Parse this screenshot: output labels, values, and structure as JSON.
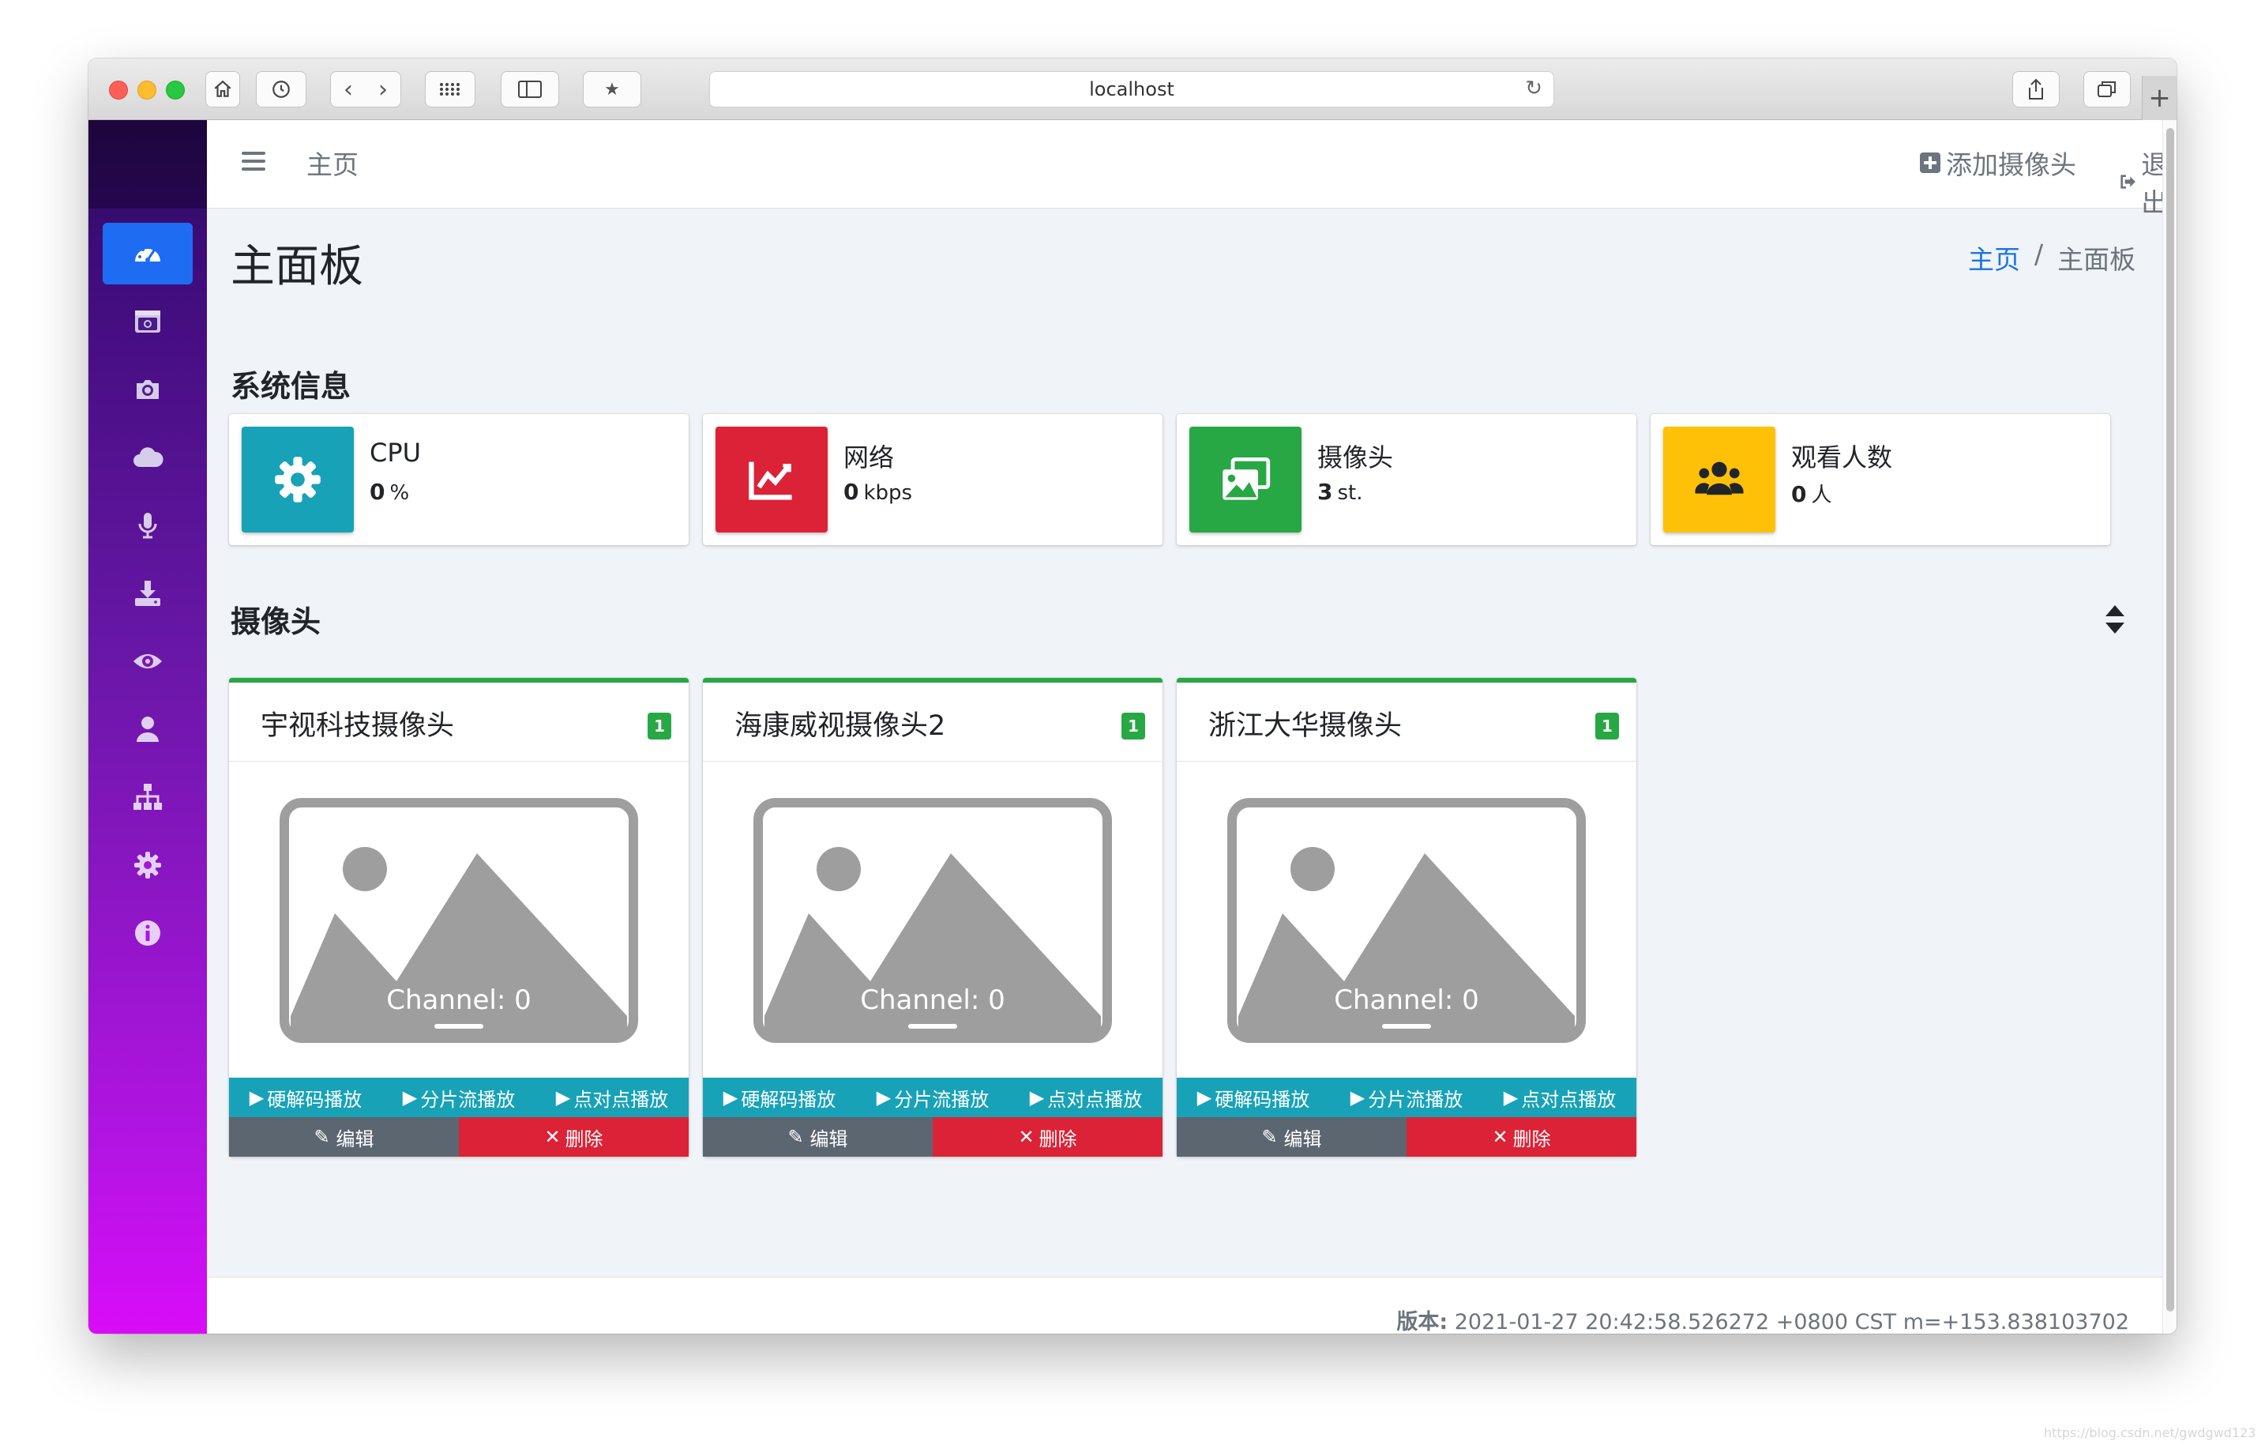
{
  "browser": {
    "url": "localhost"
  },
  "navbar": {
    "home_label": "主页",
    "add_camera_label": "添加摄像头",
    "logout_label": "退出"
  },
  "page": {
    "title": "主面板",
    "breadcrumb": [
      "主页",
      "/",
      "主面板"
    ]
  },
  "sections": {
    "system_info": "系统信息",
    "cameras": "摄像头"
  },
  "info_boxes": [
    {
      "label": "CPU",
      "value": "0",
      "unit": "%",
      "color": "#17a2b8",
      "icon": "gear-icon"
    },
    {
      "label": "网络",
      "value": "0",
      "unit": "kbps",
      "color": "#dc2236",
      "icon": "chart-area-icon"
    },
    {
      "label": "摄像头",
      "value": "3",
      "unit": "st.",
      "color": "#28a745",
      "icon": "images-icon"
    },
    {
      "label": "观看人数",
      "value": "0",
      "unit": "人",
      "color": "#ffc107",
      "icon": "users-icon"
    }
  ],
  "cameras": [
    {
      "name": "宇视科技摄像头",
      "badge": "1",
      "channel": "Channel: 0"
    },
    {
      "name": "海康威视摄像头2",
      "badge": "1",
      "channel": "Channel: 0"
    },
    {
      "name": "浙江大华摄像头",
      "badge": "1",
      "channel": "Channel: 0"
    }
  ],
  "camera_actions": {
    "hw_decode": "硬解码播放",
    "hls": "分片流播放",
    "p2p": "点对点播放",
    "edit": "编辑",
    "delete": "删除"
  },
  "footer": {
    "version_label": "版本:",
    "version_value": "2021-01-27 20:42:58.526272 +0800 CST m=+153.838103702"
  },
  "sidebar": {
    "items": [
      "dashboard-icon",
      "camera-window-icon",
      "camera-icon",
      "cloud-icon",
      "microphone-icon",
      "download-icon",
      "eye-icon",
      "user-icon",
      "sitemap-icon",
      "cog-icon",
      "info-icon"
    ]
  },
  "colors": {
    "accent": "#1e6cf2",
    "success": "#28a745",
    "info": "#17a2b8",
    "danger": "#dc2236",
    "warning": "#ffc107"
  },
  "watermark": "https://blog.csdn.net/gwdgwd123"
}
